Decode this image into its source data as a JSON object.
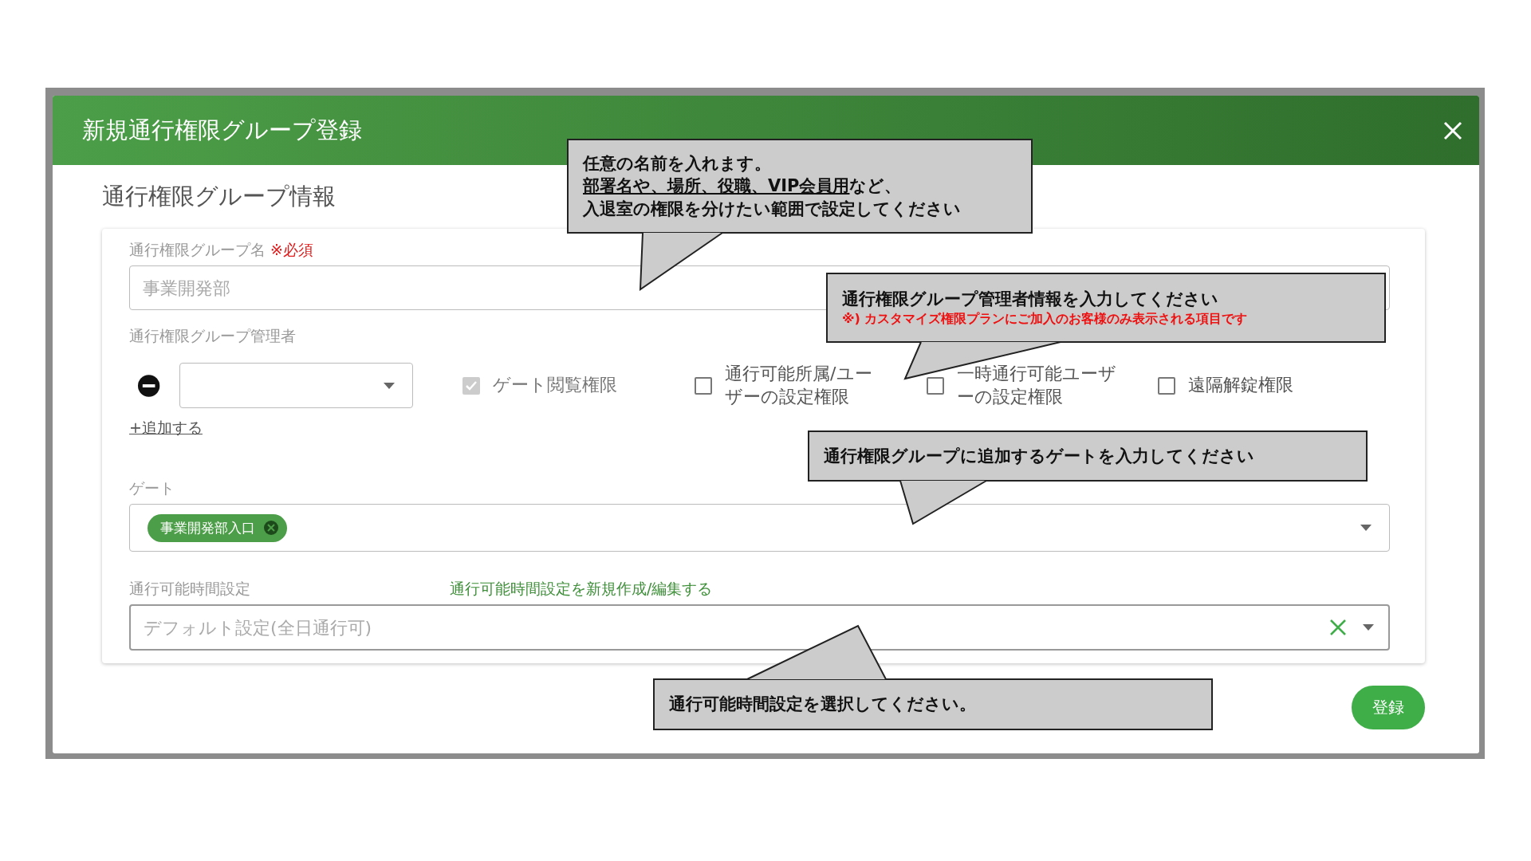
{
  "dialog": {
    "title": "新規通行権限グループ登録"
  },
  "section_title": "通行権限グループ情報",
  "group_name": {
    "label": "通行権限グループ名",
    "required": "※必須",
    "placeholder": "事業開発部"
  },
  "managers": {
    "label": "通行権限グループ管理者",
    "rows": [
      {
        "permissions": [
          {
            "label": "ゲート閲覧権限",
            "checked": true,
            "disabled": true
          },
          {
            "label": "通行可能所属/ユーザーの設定権限",
            "checked": false,
            "disabled": false
          },
          {
            "label": "一時通行可能ユーザーの設定権限",
            "checked": false,
            "disabled": false
          },
          {
            "label": "遠隔解錠権限",
            "checked": false,
            "disabled": false
          }
        ]
      }
    ],
    "add_link": "+追加する"
  },
  "gate": {
    "label": "ゲート",
    "chips": [
      {
        "label": "事業開発部入口"
      }
    ]
  },
  "time_setting": {
    "label": "通行可能時間設定",
    "link": "通行可能時間設定を新規作成/編集する",
    "placeholder": "デフォルト設定(全日通行可)"
  },
  "submit": "登録",
  "callouts": [
    {
      "lines": [
        [
          {
            "text": "任意の名前を入れます。",
            "underlined": false
          }
        ],
        [
          {
            "text": "部署名や、場所、役職、VIP会員用",
            "underlined": true
          },
          {
            "text": "など、",
            "underlined": false
          }
        ],
        [
          {
            "text": "入退室の権限を分けたい範囲で設定してください",
            "underlined": false
          }
        ]
      ]
    },
    {
      "lines": [
        [
          {
            "text": "通行権限グループ管理者情報を入力してください",
            "underlined": false
          }
        ]
      ],
      "note": "※) カスタマイズ権限プランにご加入のお客様のみ表示される項目です"
    },
    {
      "lines": [
        [
          {
            "text": "通行権限グループに追加するゲートを入力してください",
            "underlined": false
          }
        ]
      ]
    },
    {
      "lines": [
        [
          {
            "text": "通行可能時間設定を選択してください。",
            "underlined": false
          }
        ]
      ]
    }
  ]
}
